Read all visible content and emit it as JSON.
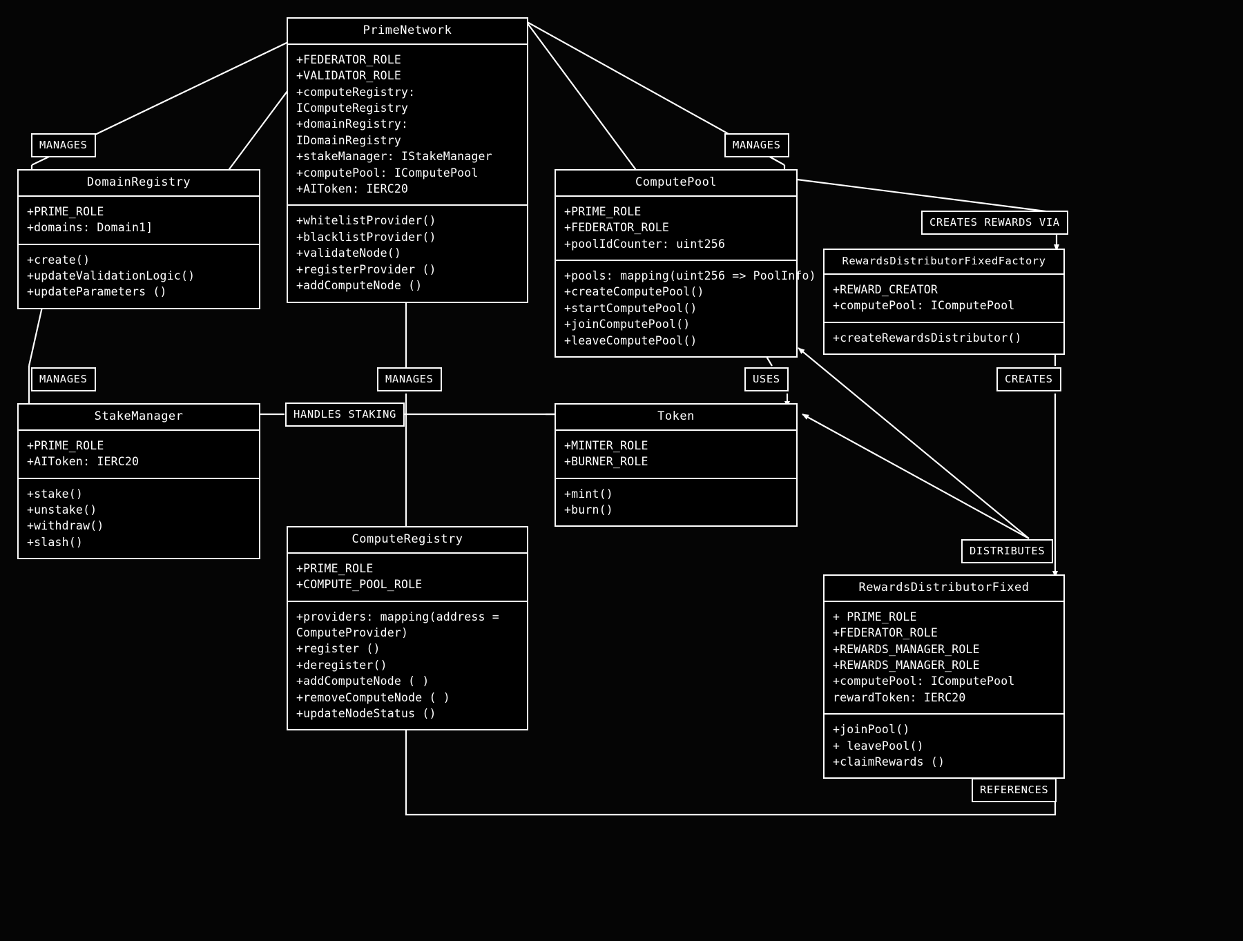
{
  "diagram": {
    "type": "uml-class-diagram",
    "background_color": "#000000",
    "stroke_color": "#ffffff",
    "text_color": "#ffffff"
  },
  "classes": [
    {
      "id": "prime-network",
      "name": "PrimeNetwork",
      "attributes": [
        "+FEDERATOR_ROLE",
        "+VALIDATOR_ROLE",
        "+computeRegistry: IComputeRegistry",
        "+domainRegistry: IDomainRegistry",
        "+stakeManager: IStakeManager",
        "+computePool: IComputePool",
        "+AIToken: IERC20"
      ],
      "methods": [
        "+whitelistProvider()",
        "+blacklistProvider()",
        "+validateNode()",
        "+registerProvider ()",
        "+addComputeNode ()"
      ]
    },
    {
      "id": "domain-registry",
      "name": "DomainRegistry",
      "attributes": [
        "+PRIME_ROLE",
        "+domains: Domain1]"
      ],
      "methods": [
        "+create()",
        "+updateValidationLogic()",
        "+updateParameters ()"
      ]
    },
    {
      "id": "compute-pool",
      "name": "ComputePool",
      "attributes": [
        "+PRIME_ROLE",
        "+FEDERATOR_ROLE",
        "+poolIdCounter: uint256"
      ],
      "methods": [
        "+pools: mapping(uint256 => PoolInfo)",
        "+createComputePool()",
        "+startComputePool()",
        "+joinComputePool()",
        "+leaveComputePool()"
      ]
    },
    {
      "id": "rewards-distributor-fixed-factory",
      "name": "RewardsDistributorFixedFactory",
      "attributes": [
        "+REWARD_CREATOR",
        "+computePool: IComputePool"
      ],
      "methods": [
        "+createRewardsDistributor()"
      ]
    },
    {
      "id": "stake-manager",
      "name": "StakeManager",
      "attributes": [
        "+PRIME_ROLE",
        "+AIToken: IERC20"
      ],
      "methods": [
        "+stake()",
        "+unstake()",
        "+withdraw()",
        "+slash()"
      ]
    },
    {
      "id": "token",
      "name": "Token",
      "attributes": [
        "+MINTER_ROLE",
        "+BURNER_ROLE"
      ],
      "methods": [
        "+mint()",
        "+burn()"
      ]
    },
    {
      "id": "compute-registry",
      "name": "ComputeRegistry",
      "attributes": [
        "+PRIME_ROLE",
        "+COMPUTE_POOL_ROLE"
      ],
      "methods": [
        "+providers: mapping(address = ComputeProvider)",
        "+register ()",
        "+deregister()",
        "+addComputeNode ( )",
        "+removeComputeNode ( )",
        "+updateNodeStatus ()"
      ]
    },
    {
      "id": "rewards-distributor-fixed",
      "name": "RewardsDistributorFixed",
      "attributes": [
        "+ PRIME_ROLE",
        "+FEDERATOR_ROLE",
        "+REWARDS_MANAGER_ROLE",
        "+REWARDS_MANAGER_ROLE",
        "+computePool: IComputePool",
        "rewardToken: IERC20"
      ],
      "methods": [
        "+joinPool()",
        "+ leavePool()",
        "+claimRewards ()"
      ]
    }
  ],
  "relationship_labels": [
    {
      "id": "manages-domain-registry",
      "text": "MANAGES"
    },
    {
      "id": "manages-compute-pool",
      "text": "MANAGES"
    },
    {
      "id": "creates-rewards-via",
      "text": "CREATES REWARDS VIA"
    },
    {
      "id": "manages-stake-manager",
      "text": "MANAGES"
    },
    {
      "id": "manages-compute-registry",
      "text": "MANAGES"
    },
    {
      "id": "uses-token",
      "text": "USES"
    },
    {
      "id": "creates",
      "text": "CREATES"
    },
    {
      "id": "handles-staking",
      "text": "HANDLES STAKING"
    },
    {
      "id": "distributes",
      "text": "DISTRIBUTES"
    },
    {
      "id": "references",
      "text": "REFERENCES"
    }
  ]
}
